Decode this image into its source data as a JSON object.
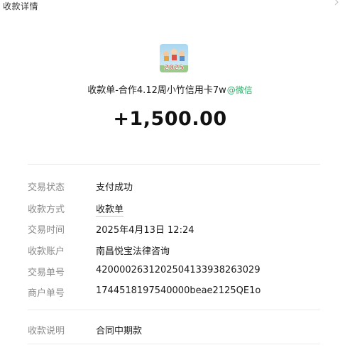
{
  "window": {
    "title": "收款详情"
  },
  "header": {
    "avatar_text": "2025",
    "merchant_name": "收款单-合作4.12周小竹信用卡7w",
    "source_tag": "@微信",
    "amount": "+1,500.00"
  },
  "details": [
    {
      "label": "交易状态",
      "value": "支付成功"
    },
    {
      "label": "收款方式",
      "value": "收款单"
    },
    {
      "label": "交易时间",
      "value": "2025年4月13日 12:24"
    },
    {
      "label": "收款账户",
      "value": "南昌悦宝法律咨询"
    },
    {
      "label": "交易单号",
      "value": "4200002631202504133938263029"
    },
    {
      "label": "商户单号",
      "value": "1744518197540000beae2125QE1o"
    }
  ],
  "note": {
    "label": "收款说明",
    "value": "合同中期款"
  },
  "colors": {
    "wechat_green": "#2aae67",
    "label_gray": "#8a8a8a",
    "divider": "#ececec"
  }
}
